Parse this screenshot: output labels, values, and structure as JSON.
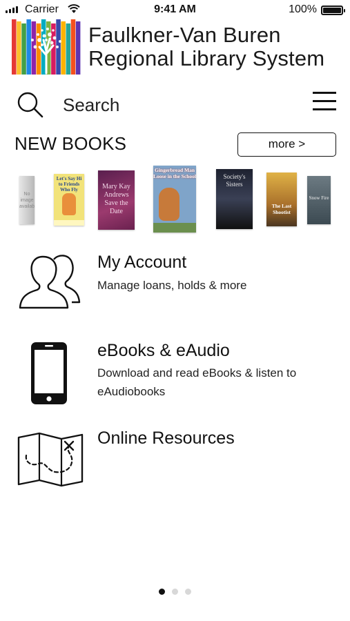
{
  "status_bar": {
    "carrier": "Carrier",
    "time": "9:41 AM",
    "battery": "100%"
  },
  "header": {
    "org_line1": "Faulkner-Van Buren",
    "org_line2": "Regional Library System"
  },
  "search": {
    "label": "Search",
    "icon": "search-icon",
    "menu_icon": "hamburger-menu-icon"
  },
  "new_books": {
    "title": "NEW BOOKS",
    "more_label": "more >",
    "covers": [
      {
        "title_text": "No image available"
      },
      {
        "title_text": "Let's Say Hi to Friends Who Fly"
      },
      {
        "title_text": "Mary Kay Andrews Save the Date"
      },
      {
        "title_text": "Gingerbread Man Loose in the School"
      },
      {
        "title_text": "Society's Sisters"
      },
      {
        "title_text": "The Last Shootist"
      },
      {
        "title_text": "Snow Fire"
      }
    ]
  },
  "menu": [
    {
      "title": "My Account",
      "subtitle": "Manage loans, holds & more",
      "icon": "people-icon"
    },
    {
      "title": "eBooks & eAudio",
      "subtitle": "Download and read eBooks & listen to eAudiobooks",
      "icon": "phone-icon"
    },
    {
      "title": "Online Resources",
      "subtitle": "",
      "icon": "map-icon"
    }
  ],
  "pager": {
    "count": 3,
    "active": 1
  }
}
